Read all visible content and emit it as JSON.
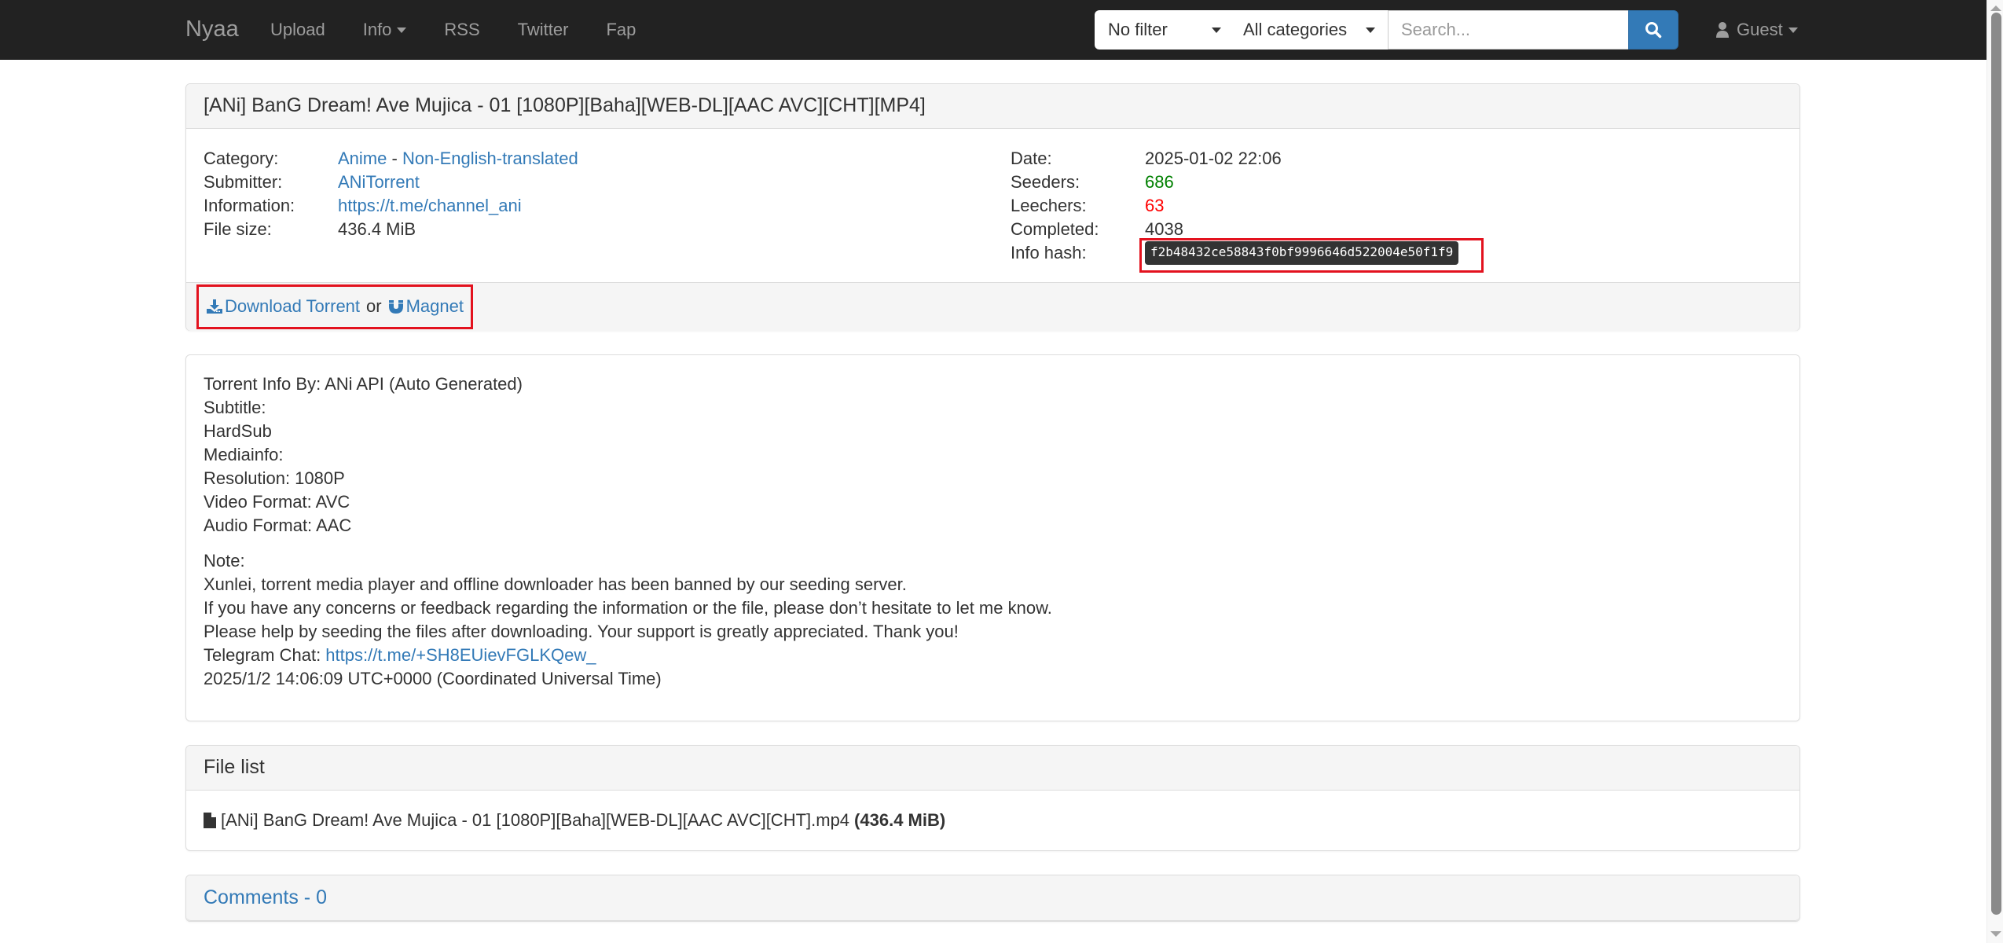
{
  "navbar": {
    "brand": "Nyaa",
    "links": [
      {
        "label": "Upload",
        "dropdown": false
      },
      {
        "label": "Info",
        "dropdown": true
      },
      {
        "label": "RSS",
        "dropdown": false
      },
      {
        "label": "Twitter",
        "dropdown": false
      },
      {
        "label": "Fap",
        "dropdown": false
      }
    ],
    "filter_selected": "No filter",
    "category_selected": "All categories",
    "search_placeholder": "Search...",
    "search_value": "",
    "search_icon": "search-icon",
    "user_label": "Guest",
    "user_icon": "user-icon"
  },
  "torrent": {
    "title": "[ANi] BanG Dream! Ave Mujica - 01 [1080P][Baha][WEB-DL][AAC AVC][CHT][MP4]",
    "left": {
      "category_label": "Category:",
      "category_main": "Anime",
      "category_sep": "-",
      "category_sub": "Non-English-translated",
      "submitter_label": "Submitter:",
      "submitter": "ANiTorrent",
      "information_label": "Information:",
      "information": "https://t.me/channel_ani",
      "filesize_label": "File size:",
      "filesize": "436.4 MiB"
    },
    "right": {
      "date_label": "Date:",
      "date": "2025-01-02 22:06",
      "seeders_label": "Seeders:",
      "seeders": "686",
      "leechers_label": "Leechers:",
      "leechers": "63",
      "completed_label": "Completed:",
      "completed": "4038",
      "infohash_label": "Info hash:",
      "infohash": "f2b48432ce58843f0bf9996646d522004e50f1f9"
    },
    "download_label": "Download Torrent",
    "or_label": "or",
    "magnet_label": "Magnet",
    "colors": {
      "seeders": "#008000",
      "leechers": "#ff0000",
      "link": "#337ab7",
      "highlight": "#e3121e"
    }
  },
  "description": {
    "block1": [
      "Torrent Info By: ANi API (Auto Generated)",
      "Subtitle:",
      "HardSub",
      "Mediainfo:",
      "Resolution: 1080P",
      "Video Format: AVC",
      "Audio Format: AAC"
    ],
    "block2": [
      "Note:",
      "Xunlei, torrent media player and offline downloader has been banned by our seeding server.",
      "If you have any concerns or feedback regarding the information or the file, please don’t hesitate to let me know.",
      "Please help by seeding the files after downloading. Your support is greatly appreciated. Thank you!"
    ],
    "telegram_label": "Telegram Chat: ",
    "telegram_link": "https://t.me/+SH8EUievFGLKQew_",
    "timestamp": "2025/1/2 14:06:09 UTC+0000 (Coordinated Universal Time)"
  },
  "file_list": {
    "title": "File list",
    "files": [
      {
        "name": "[ANi] BanG Dream! Ave Mujica - 01 [1080P][Baha][WEB-DL][AAC AVC][CHT].mp4",
        "size": "(436.4 MiB)"
      }
    ]
  },
  "comments": {
    "label": "Comments - 0"
  }
}
